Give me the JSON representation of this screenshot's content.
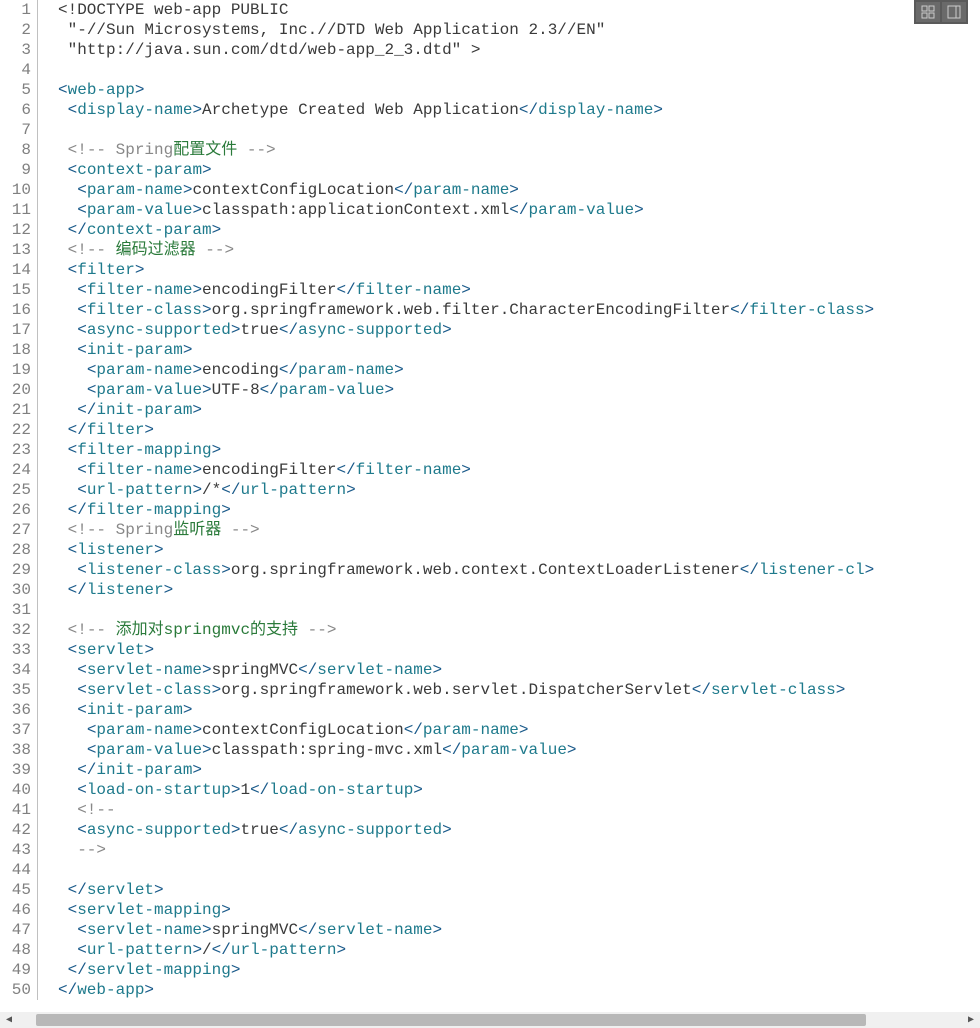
{
  "editor": {
    "line_count": 50,
    "lines": [
      {
        "n": 1,
        "indent": 0,
        "tokens": [
          {
            "t": "text",
            "v": "<!DOCTYPE web-app PUBLIC"
          }
        ]
      },
      {
        "n": 2,
        "indent": 1,
        "tokens": [
          {
            "t": "text",
            "v": "\"-//Sun Microsystems, Inc.//DTD Web Application 2.3//EN\""
          }
        ]
      },
      {
        "n": 3,
        "indent": 1,
        "tokens": [
          {
            "t": "text",
            "v": "\"http://java.sun.com/dtd/web-app_2_3.dtd\" >"
          }
        ]
      },
      {
        "n": 4,
        "indent": 0,
        "tokens": []
      },
      {
        "n": 5,
        "indent": 0,
        "tokens": [
          {
            "t": "open",
            "v": "web-app"
          }
        ]
      },
      {
        "n": 6,
        "indent": 1,
        "tokens": [
          {
            "t": "open",
            "v": "display-name"
          },
          {
            "t": "text",
            "v": "Archetype Created Web Application"
          },
          {
            "t": "close",
            "v": "display-name"
          }
        ]
      },
      {
        "n": 7,
        "indent": 0,
        "tokens": []
      },
      {
        "n": 8,
        "indent": 1,
        "tokens": [
          {
            "t": "comment",
            "v": "<!-- Spring"
          },
          {
            "t": "comment-cn",
            "v": "配置文件"
          },
          {
            "t": "comment",
            "v": " -->"
          }
        ]
      },
      {
        "n": 9,
        "indent": 1,
        "tokens": [
          {
            "t": "open",
            "v": "context-param"
          }
        ]
      },
      {
        "n": 10,
        "indent": 2,
        "tokens": [
          {
            "t": "open",
            "v": "param-name"
          },
          {
            "t": "text",
            "v": "contextConfigLocation"
          },
          {
            "t": "close",
            "v": "param-name"
          }
        ]
      },
      {
        "n": 11,
        "indent": 2,
        "tokens": [
          {
            "t": "open",
            "v": "param-value"
          },
          {
            "t": "text",
            "v": "classpath:applicationContext.xml"
          },
          {
            "t": "close",
            "v": "param-value"
          }
        ]
      },
      {
        "n": 12,
        "indent": 1,
        "tokens": [
          {
            "t": "close",
            "v": "context-param"
          }
        ]
      },
      {
        "n": 13,
        "indent": 1,
        "tokens": [
          {
            "t": "comment",
            "v": "<!-- "
          },
          {
            "t": "comment-cn",
            "v": "编码过滤器"
          },
          {
            "t": "comment",
            "v": " -->"
          }
        ]
      },
      {
        "n": 14,
        "indent": 1,
        "tokens": [
          {
            "t": "open",
            "v": "filter"
          }
        ]
      },
      {
        "n": 15,
        "indent": 2,
        "tokens": [
          {
            "t": "open",
            "v": "filter-name"
          },
          {
            "t": "text",
            "v": "encodingFilter"
          },
          {
            "t": "close",
            "v": "filter-name"
          }
        ]
      },
      {
        "n": 16,
        "indent": 2,
        "tokens": [
          {
            "t": "open",
            "v": "filter-class"
          },
          {
            "t": "text",
            "v": "org.springframework.web.filter.CharacterEncodingFilter"
          },
          {
            "t": "close",
            "v": "filter-class"
          }
        ]
      },
      {
        "n": 17,
        "indent": 2,
        "tokens": [
          {
            "t": "open",
            "v": "async-supported"
          },
          {
            "t": "text",
            "v": "true"
          },
          {
            "t": "close",
            "v": "async-supported"
          }
        ]
      },
      {
        "n": 18,
        "indent": 2,
        "tokens": [
          {
            "t": "open",
            "v": "init-param"
          }
        ]
      },
      {
        "n": 19,
        "indent": 3,
        "tokens": [
          {
            "t": "open",
            "v": "param-name"
          },
          {
            "t": "text",
            "v": "encoding"
          },
          {
            "t": "close",
            "v": "param-name"
          }
        ]
      },
      {
        "n": 20,
        "indent": 3,
        "tokens": [
          {
            "t": "open",
            "v": "param-value"
          },
          {
            "t": "text",
            "v": "UTF-8"
          },
          {
            "t": "close",
            "v": "param-value"
          }
        ]
      },
      {
        "n": 21,
        "indent": 2,
        "tokens": [
          {
            "t": "close",
            "v": "init-param"
          }
        ]
      },
      {
        "n": 22,
        "indent": 1,
        "tokens": [
          {
            "t": "close",
            "v": "filter"
          }
        ]
      },
      {
        "n": 23,
        "indent": 1,
        "tokens": [
          {
            "t": "open",
            "v": "filter-mapping"
          }
        ]
      },
      {
        "n": 24,
        "indent": 2,
        "tokens": [
          {
            "t": "open",
            "v": "filter-name"
          },
          {
            "t": "text",
            "v": "encodingFilter"
          },
          {
            "t": "close",
            "v": "filter-name"
          }
        ]
      },
      {
        "n": 25,
        "indent": 2,
        "tokens": [
          {
            "t": "open",
            "v": "url-pattern"
          },
          {
            "t": "text",
            "v": "/*"
          },
          {
            "t": "close",
            "v": "url-pattern"
          }
        ]
      },
      {
        "n": 26,
        "indent": 1,
        "tokens": [
          {
            "t": "close",
            "v": "filter-mapping"
          }
        ]
      },
      {
        "n": 27,
        "indent": 1,
        "tokens": [
          {
            "t": "comment",
            "v": "<!-- Spring"
          },
          {
            "t": "comment-cn",
            "v": "监听器"
          },
          {
            "t": "comment",
            "v": " -->"
          }
        ]
      },
      {
        "n": 28,
        "indent": 1,
        "tokens": [
          {
            "t": "open",
            "v": "listener"
          }
        ]
      },
      {
        "n": 29,
        "indent": 2,
        "tokens": [
          {
            "t": "open",
            "v": "listener-class"
          },
          {
            "t": "text",
            "v": "org.springframework.web.context.ContextLoaderListener"
          },
          {
            "t": "close",
            "v": "listener-cl"
          }
        ]
      },
      {
        "n": 30,
        "indent": 1,
        "tokens": [
          {
            "t": "close",
            "v": "listener"
          }
        ]
      },
      {
        "n": 31,
        "indent": 0,
        "tokens": []
      },
      {
        "n": 32,
        "indent": 1,
        "tokens": [
          {
            "t": "comment",
            "v": "<!-- "
          },
          {
            "t": "comment-cn",
            "v": "添加对springmvc的支持"
          },
          {
            "t": "comment",
            "v": " -->"
          }
        ]
      },
      {
        "n": 33,
        "indent": 1,
        "tokens": [
          {
            "t": "open",
            "v": "servlet"
          }
        ]
      },
      {
        "n": 34,
        "indent": 2,
        "tokens": [
          {
            "t": "open",
            "v": "servlet-name"
          },
          {
            "t": "text",
            "v": "springMVC"
          },
          {
            "t": "close",
            "v": "servlet-name"
          }
        ]
      },
      {
        "n": 35,
        "indent": 2,
        "tokens": [
          {
            "t": "open",
            "v": "servlet-class"
          },
          {
            "t": "text",
            "v": "org.springframework.web.servlet.DispatcherServlet"
          },
          {
            "t": "close",
            "v": "servlet-class"
          }
        ]
      },
      {
        "n": 36,
        "indent": 2,
        "tokens": [
          {
            "t": "open",
            "v": "init-param"
          }
        ]
      },
      {
        "n": 37,
        "indent": 3,
        "tokens": [
          {
            "t": "open",
            "v": "param-name"
          },
          {
            "t": "text",
            "v": "contextConfigLocation"
          },
          {
            "t": "close",
            "v": "param-name"
          }
        ]
      },
      {
        "n": 38,
        "indent": 3,
        "tokens": [
          {
            "t": "open",
            "v": "param-value"
          },
          {
            "t": "text",
            "v": "classpath:spring-mvc.xml"
          },
          {
            "t": "close",
            "v": "param-value"
          }
        ]
      },
      {
        "n": 39,
        "indent": 2,
        "tokens": [
          {
            "t": "close",
            "v": "init-param"
          }
        ]
      },
      {
        "n": 40,
        "indent": 2,
        "tokens": [
          {
            "t": "open",
            "v": "load-on-startup"
          },
          {
            "t": "text",
            "v": "1"
          },
          {
            "t": "close",
            "v": "load-on-startup"
          }
        ]
      },
      {
        "n": 41,
        "indent": 2,
        "tokens": [
          {
            "t": "comment",
            "v": "<!--"
          }
        ]
      },
      {
        "n": 42,
        "indent": 2,
        "tokens": [
          {
            "t": "open",
            "v": "async-supported"
          },
          {
            "t": "text",
            "v": "true"
          },
          {
            "t": "close",
            "v": "async-supported"
          }
        ]
      },
      {
        "n": 43,
        "indent": 2,
        "tokens": [
          {
            "t": "comment",
            "v": "-->"
          }
        ]
      },
      {
        "n": 44,
        "indent": 0,
        "tokens": []
      },
      {
        "n": 45,
        "indent": 1,
        "tokens": [
          {
            "t": "close",
            "v": "servlet"
          }
        ]
      },
      {
        "n": 46,
        "indent": 1,
        "tokens": [
          {
            "t": "open",
            "v": "servlet-mapping"
          }
        ]
      },
      {
        "n": 47,
        "indent": 2,
        "tokens": [
          {
            "t": "open",
            "v": "servlet-name"
          },
          {
            "t": "text",
            "v": "springMVC"
          },
          {
            "t": "close",
            "v": "servlet-name"
          }
        ]
      },
      {
        "n": 48,
        "indent": 2,
        "tokens": [
          {
            "t": "open",
            "v": "url-pattern"
          },
          {
            "t": "text",
            "v": "/"
          },
          {
            "t": "close",
            "v": "url-pattern"
          }
        ]
      },
      {
        "n": 49,
        "indent": 1,
        "tokens": [
          {
            "t": "close",
            "v": "servlet-mapping"
          }
        ]
      },
      {
        "n": 50,
        "indent": 0,
        "tokens": [
          {
            "t": "close",
            "v": "web-app"
          }
        ]
      }
    ]
  },
  "toolbar": {
    "btn1_name": "grid-icon",
    "btn2_name": "panel-icon"
  },
  "colors": {
    "tag": "#1e7a8c",
    "text": "#3a3a3a",
    "comment": "#888888",
    "comment_cn": "#2a7a3a",
    "gutter": "#808080"
  }
}
